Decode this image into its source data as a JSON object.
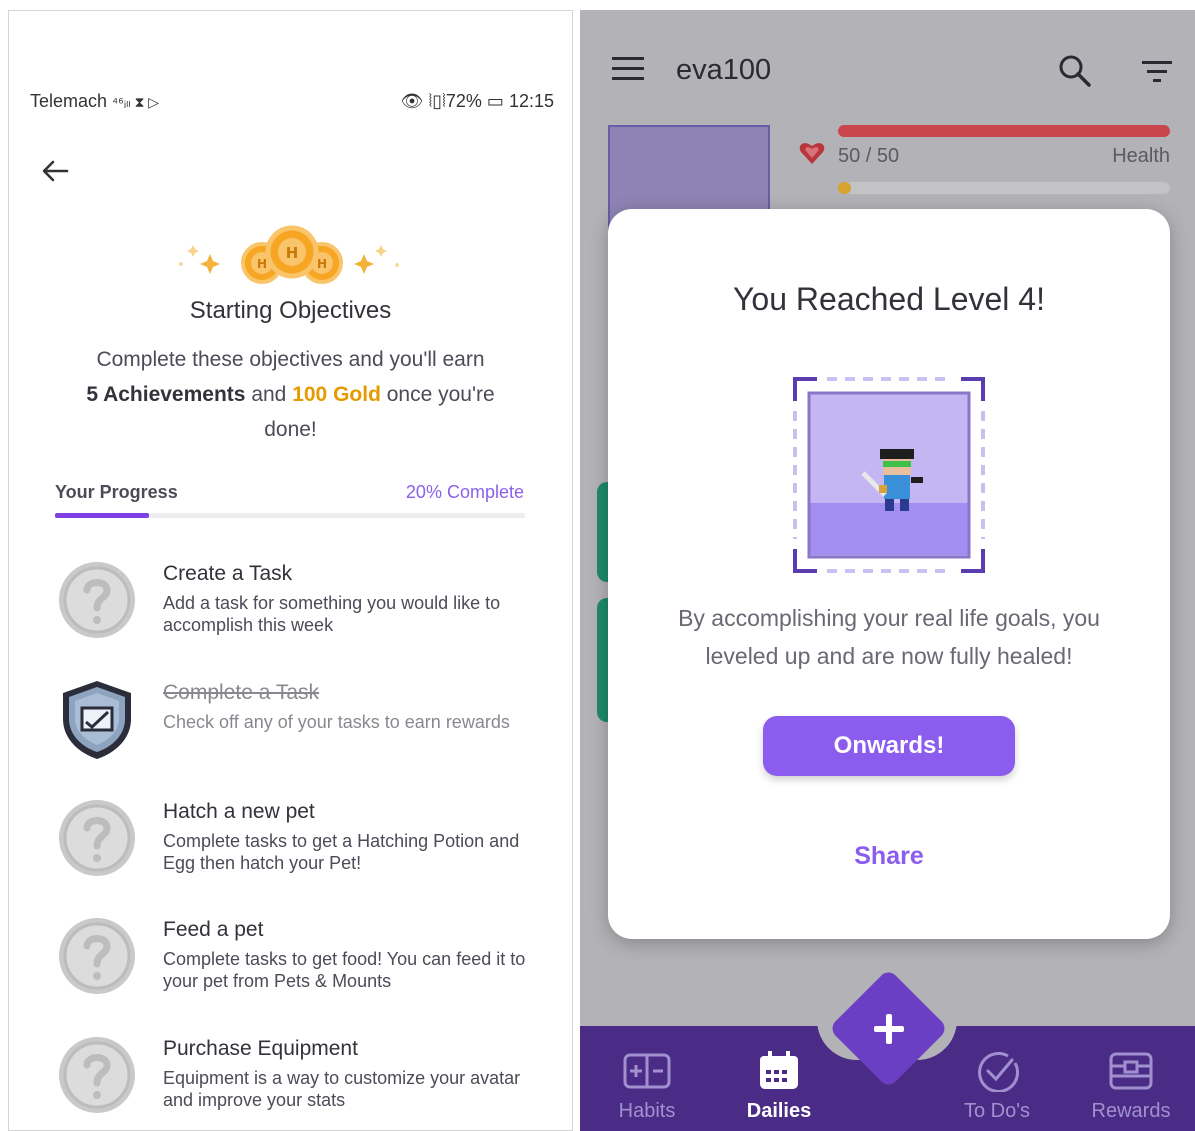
{
  "left": {
    "status_bar": {
      "carrier": "Telemach",
      "network": "⁴⁶ᵢₗₗ ⧗ ▷",
      "right": "👁 ⦚▯⦚72% ▭ 12:15"
    },
    "title": "Starting Objectives",
    "desc_pre": "Complete these objectives and you'll earn",
    "desc_achievements": "5 Achievements",
    "desc_and": "and",
    "desc_gold": "100 Gold",
    "desc_post": "once you're done!",
    "progress_label": "Your Progress",
    "progress_pct_text": "20% Complete",
    "progress_value": 0.2,
    "items": [
      {
        "title": "Create a Task",
        "desc": "Add a task for something you would like to accomplish this week",
        "done": false
      },
      {
        "title": "Complete a Task",
        "desc": "Check off any of your tasks to earn rewards",
        "done": true
      },
      {
        "title": "Hatch a new pet",
        "desc": "Complete tasks to get a Hatching Potion and Egg then hatch your Pet!",
        "done": false
      },
      {
        "title": "Feed a pet",
        "desc": "Complete tasks to get food! You can feed it to your pet from Pets & Mounts",
        "done": false
      },
      {
        "title": "Purchase Equipment",
        "desc": "Equipment is a way to customize your avatar and improve your stats",
        "done": false
      }
    ]
  },
  "right": {
    "username": "eva100",
    "health_text": "50 / 50",
    "health_label": "Health",
    "xp_value": 0.04,
    "modal": {
      "title": "You Reached Level 4!",
      "desc": "By accomplishing your real life goals, you leveled up and are now fully healed!",
      "button": "Onwards!",
      "share": "Share"
    },
    "nav": [
      "Habits",
      "Dailies",
      "To Do's",
      "Rewards"
    ],
    "nav_active": "Dailies"
  },
  "colors": {
    "accent": "#8b5ced",
    "gold": "#e59a00",
    "health": "#c9464d",
    "nav_bg": "#4a2c86"
  }
}
